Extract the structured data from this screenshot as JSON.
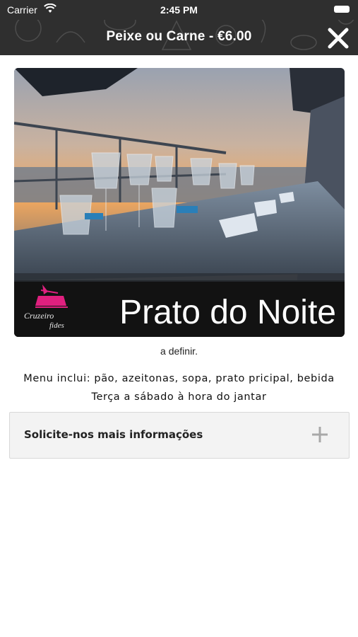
{
  "status_bar": {
    "carrier": "Carrier",
    "time": "2:45 PM",
    "wifi_icon": "wifi-icon",
    "battery_icon": "battery-icon"
  },
  "nav": {
    "title": "Peixe ou Carne - €6.00",
    "close_icon": "close-icon",
    "background_color": "#2f2f2f"
  },
  "hero": {
    "caption": "Prato do Noite",
    "logo_text_line1": "Cruzeiro",
    "logo_text_line2": "fides",
    "logo_color": "#e0207f"
  },
  "subtitle": "a definir.",
  "description": {
    "line1": "Menu inclui: pão, azeitonas, sopa, prato pricipal, bebida",
    "line2": "Terça a sábado à hora do jantar"
  },
  "info_panel": {
    "label": "Solicite-nos mais informações",
    "icon": "plus-icon"
  }
}
